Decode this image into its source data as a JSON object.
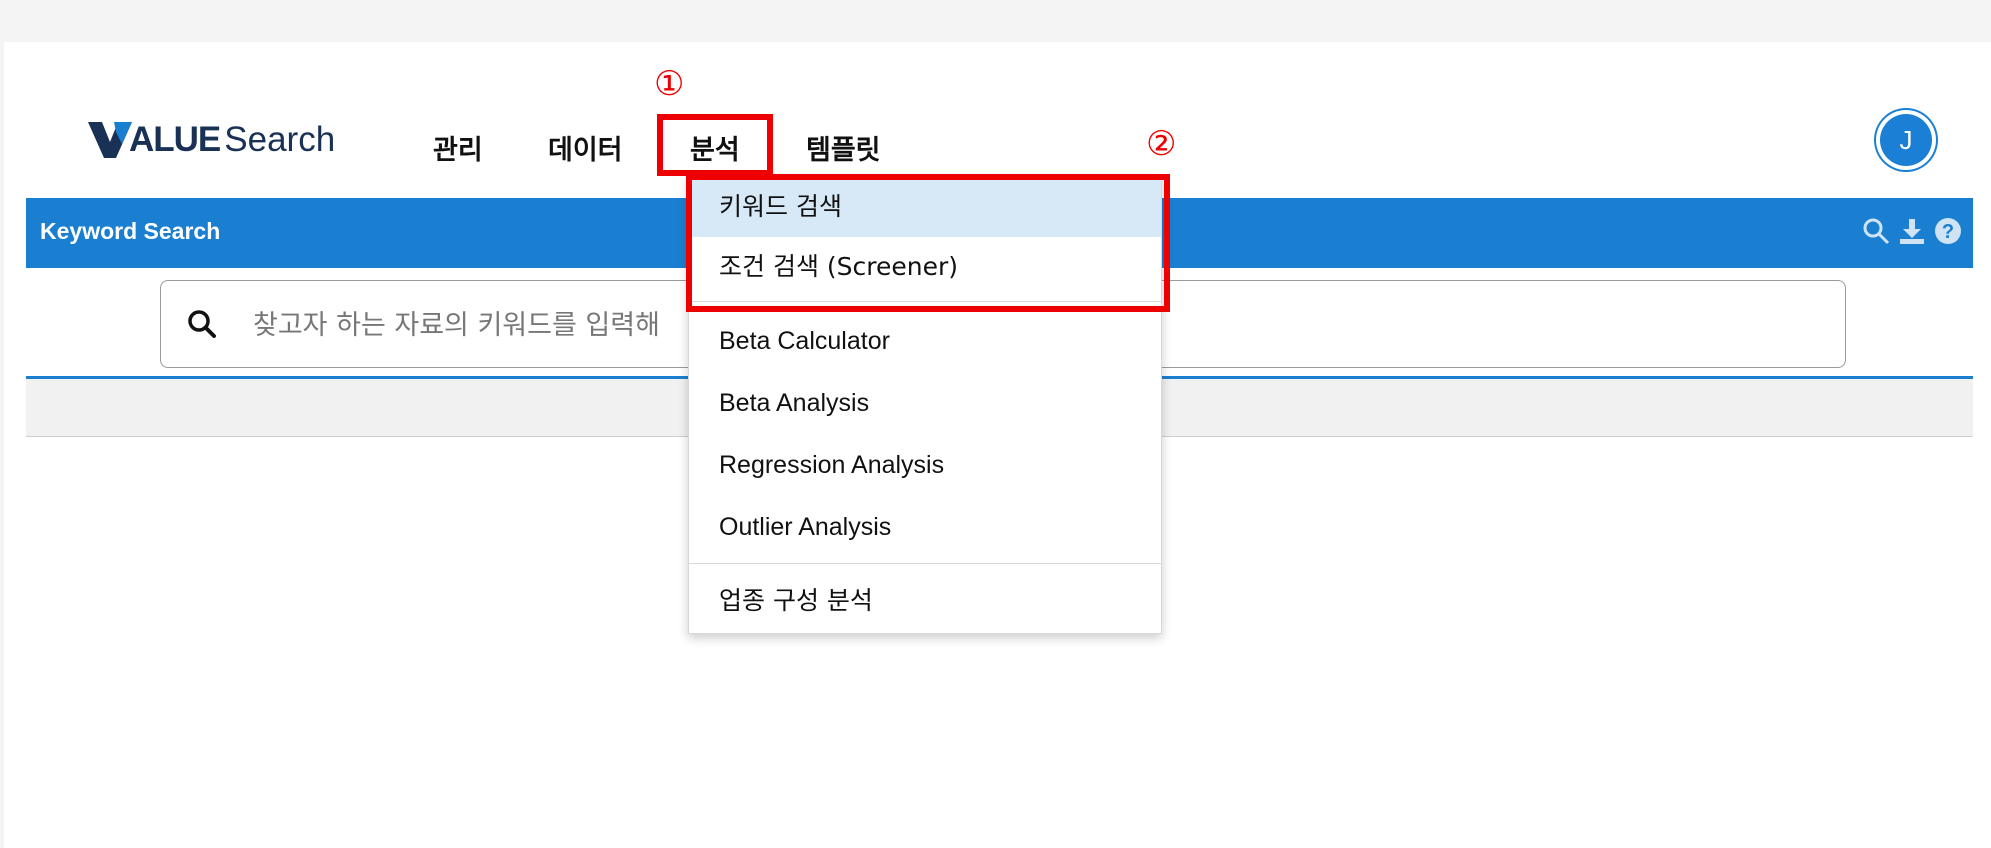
{
  "header": {
    "logo_v": "V",
    "logo_alue": "ALUE",
    "logo_search": "Search",
    "nav": [
      "관리",
      "데이터",
      "분석",
      "템플릿"
    ],
    "avatar_initial": "J"
  },
  "title_bar": {
    "title": "Keyword Search",
    "icons": [
      "search-icon",
      "download-icon",
      "help-icon"
    ]
  },
  "search": {
    "placeholder": "찾고자 하는 자료의 키워드를 입력해"
  },
  "dropdown": {
    "items": [
      "키워드 검색",
      "조건 검색 (Screener)",
      "Beta Calculator",
      "Beta Analysis",
      "Regression Analysis",
      "Outlier Analysis",
      "업종 구성 분석"
    ]
  },
  "annotations": {
    "marker_1": "①",
    "marker_2": "②"
  },
  "colors": {
    "brand_blue": "#1a7fd0",
    "annotation_red": "#ee0000",
    "logo_navy": "#1a3156"
  }
}
